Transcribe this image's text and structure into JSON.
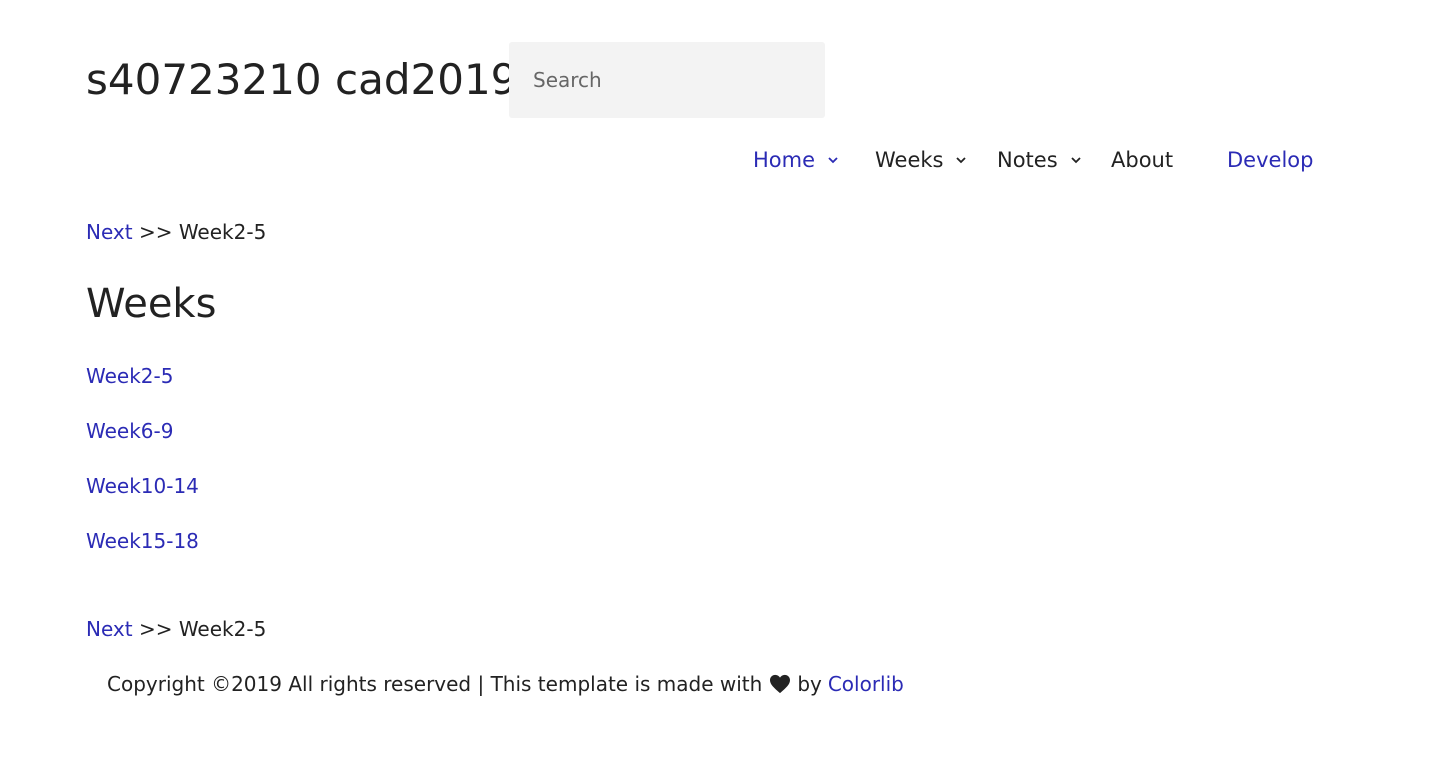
{
  "site": {
    "title": "s40723210 cad2019"
  },
  "search": {
    "placeholder": "Search"
  },
  "nav": {
    "items": [
      {
        "label": "Home",
        "has_dropdown": true,
        "active": true
      },
      {
        "label": "Weeks",
        "has_dropdown": true,
        "active": false
      },
      {
        "label": "Notes",
        "has_dropdown": true,
        "active": false
      },
      {
        "label": "About",
        "has_dropdown": false,
        "active": false
      },
      {
        "label": "Develop",
        "has_dropdown": false,
        "active": true
      }
    ]
  },
  "breadcrumb": {
    "next_label": "Next",
    "separator": ">>",
    "current": "Week2-5"
  },
  "main": {
    "heading": "Weeks",
    "links": [
      "Week2-5",
      "Week6-9",
      "Week10-14",
      "Week15-18"
    ]
  },
  "footer": {
    "text_before": "Copyright ©2019 All rights reserved | This template is made with",
    "text_by": "by",
    "link_label": "Colorlib"
  },
  "colors": {
    "link": "#2b2bb5",
    "text": "#222222",
    "search_bg": "#f3f3f3"
  },
  "icons": {
    "dropdown": "chevron-down-icon",
    "heart": "heart-icon"
  }
}
